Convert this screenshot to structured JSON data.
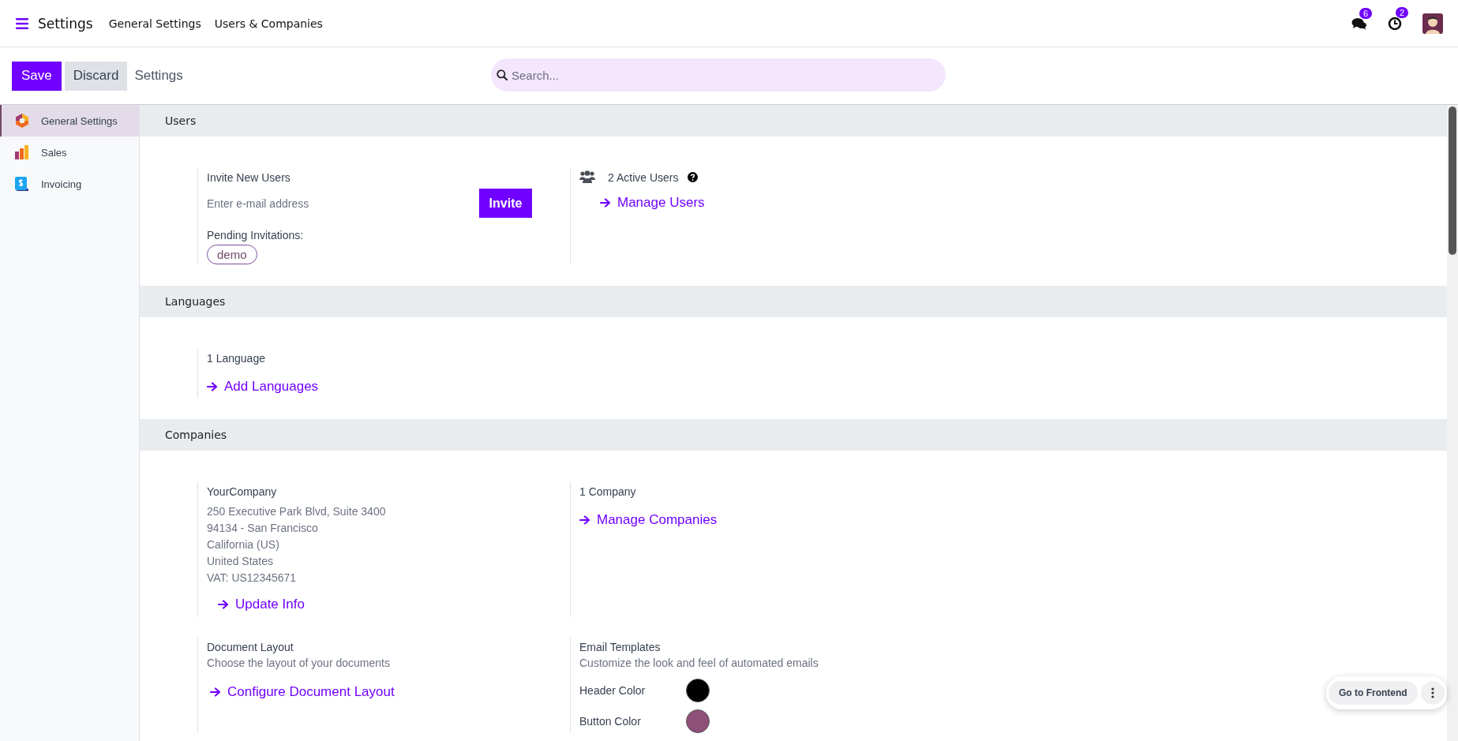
{
  "navbar": {
    "app_title": "Settings",
    "menu": [
      "General Settings",
      "Users & Companies"
    ],
    "messages_count": "6",
    "activities_count": "2"
  },
  "control_panel": {
    "save": "Save",
    "discard": "Discard",
    "breadcrumb": "Settings",
    "search": {
      "placeholder": "Search..."
    }
  },
  "sidebar": {
    "items": [
      {
        "label": "General Settings",
        "kind": "general",
        "selected": true
      },
      {
        "label": "Sales",
        "kind": "sales",
        "selected": false
      },
      {
        "label": "Invoicing",
        "kind": "invoicing",
        "selected": false
      }
    ]
  },
  "sections": [
    {
      "title": "Users",
      "settings": [
        {
          "kind": "invite",
          "title": "Invite New Users",
          "placeholder": "Enter e-mail address",
          "button": "Invite",
          "pending_label": "Pending Invitations:",
          "pending": [
            "demo"
          ]
        },
        {
          "kind": "users",
          "title": "2 Active Users",
          "link": "Manage Users"
        }
      ]
    },
    {
      "title": "Languages",
      "settings": [
        {
          "kind": "plain",
          "title": "1 Language",
          "link": "Add Languages"
        }
      ]
    },
    {
      "title": "Companies",
      "settings": [
        {
          "kind": "company",
          "title": "YourCompany",
          "address": [
            "250 Executive Park Blvd, Suite 3400",
            "94134 - San Francisco",
            "California (US)",
            "United States",
            "VAT:  US12345671"
          ],
          "link": "Update Info"
        },
        {
          "kind": "plain",
          "title": "1 Company",
          "link": "Manage Companies"
        },
        {
          "kind": "description",
          "title": "Document Layout",
          "description": "Choose the layout of your documents",
          "link": "Configure Document Layout"
        },
        {
          "kind": "colors",
          "title": "Email Templates",
          "description": "Customize the look and feel of automated emails",
          "colors": [
            {
              "label": "Header Color",
              "color": "#000000"
            },
            {
              "label": "Button Color",
              "color": "#8e4f78"
            }
          ]
        }
      ]
    }
  ],
  "floating": {
    "button": "Go to Frontend"
  }
}
